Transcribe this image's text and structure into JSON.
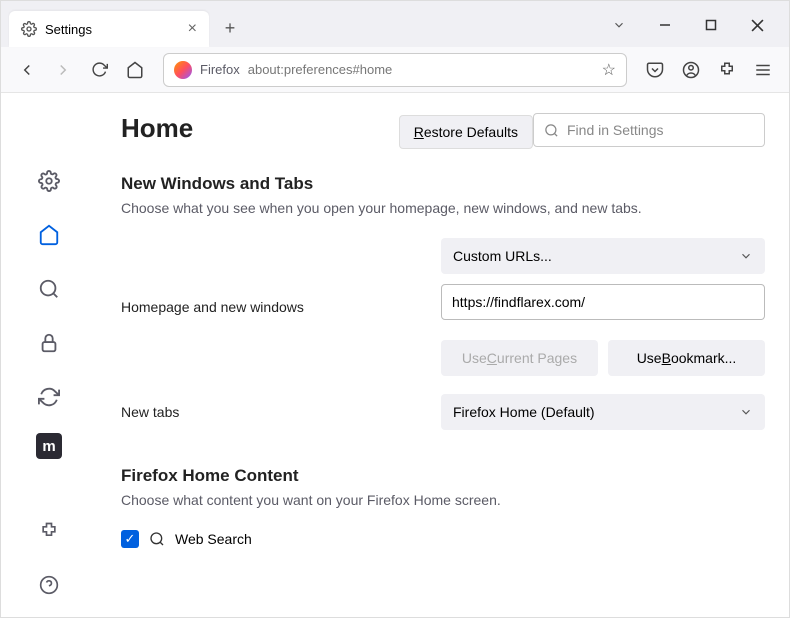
{
  "tab": {
    "title": "Settings"
  },
  "url": {
    "scheme_label": "Firefox",
    "address": "about:preferences#home"
  },
  "search": {
    "placeholder": "Find in Settings"
  },
  "page": {
    "heading": "Home",
    "restore": "Restore Defaults",
    "section1": {
      "title": "New Windows and Tabs",
      "desc": "Choose what you see when you open your homepage, new windows, and new tabs.",
      "homepage_label": "Homepage and new windows",
      "homepage_select": "Custom URLs...",
      "homepage_url": "https://findflarex.com/",
      "use_current": "Use Current Pages",
      "use_bookmark": "Use Bookmark...",
      "newtabs_label": "New tabs",
      "newtabs_select": "Firefox Home (Default)"
    },
    "section2": {
      "title": "Firefox Home Content",
      "desc": "Choose what content you want on your Firefox Home screen.",
      "web_search": "Web Search"
    }
  }
}
